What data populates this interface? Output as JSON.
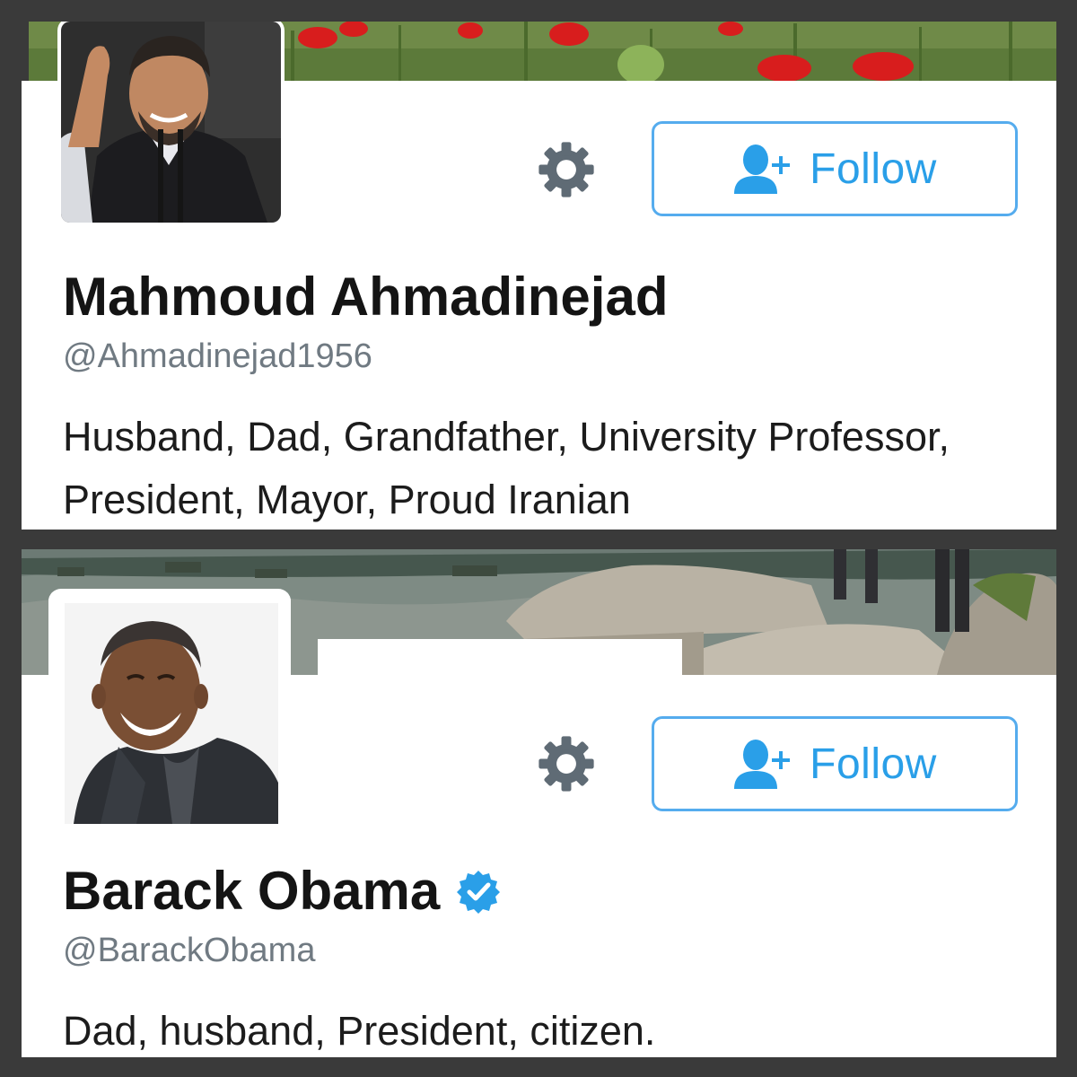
{
  "profiles": [
    {
      "name": "Mahmoud Ahmadinejad",
      "handle": "@Ahmadinejad1956",
      "bio": "Husband, Dad, Grandfather, University Professor, President, Mayor, Proud Iranian",
      "verified": false,
      "follow_label": "Follow",
      "settings_icon": "gear-icon",
      "follow_icon": "add-user-icon",
      "banner": "red poppy field"
    },
    {
      "name": "Barack Obama",
      "handle": "@BarackObama",
      "bio": "Dad, husband, President, citizen.",
      "verified": true,
      "follow_label": "Follow",
      "settings_icon": "gear-icon",
      "follow_icon": "add-user-icon",
      "verified_icon": "verified-badge-icon",
      "banner": "rocky mountain landscape"
    }
  ],
  "colors": {
    "accent": "#55acee",
    "follow_text": "#2a9fe8",
    "name_text": "#141414",
    "handle_text": "#707a82",
    "gear": "#5f6b75",
    "background": "#3a3a3a"
  }
}
